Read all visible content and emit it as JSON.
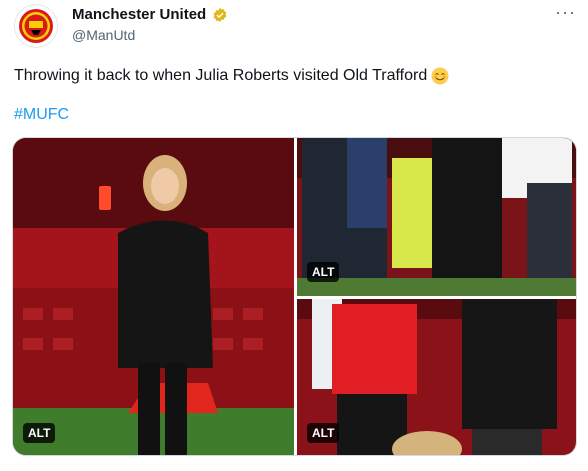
{
  "tweet": {
    "author_name": "Manchester United",
    "handle": "@ManUtd",
    "text": "Throwing it back to when Julia Roberts visited Old Trafford",
    "hashtag": "#MUFC",
    "verified_icon": "gold-verified-badge",
    "more_icon": "more-options-icon",
    "emoji_icon": "smiling-face-emoji"
  },
  "media": {
    "alt_badges": [
      "ALT",
      "ALT",
      "ALT"
    ]
  },
  "colors": {
    "link": "#1d9bf0",
    "verified": "#e2b719",
    "stadium_red": "#b0141a"
  }
}
